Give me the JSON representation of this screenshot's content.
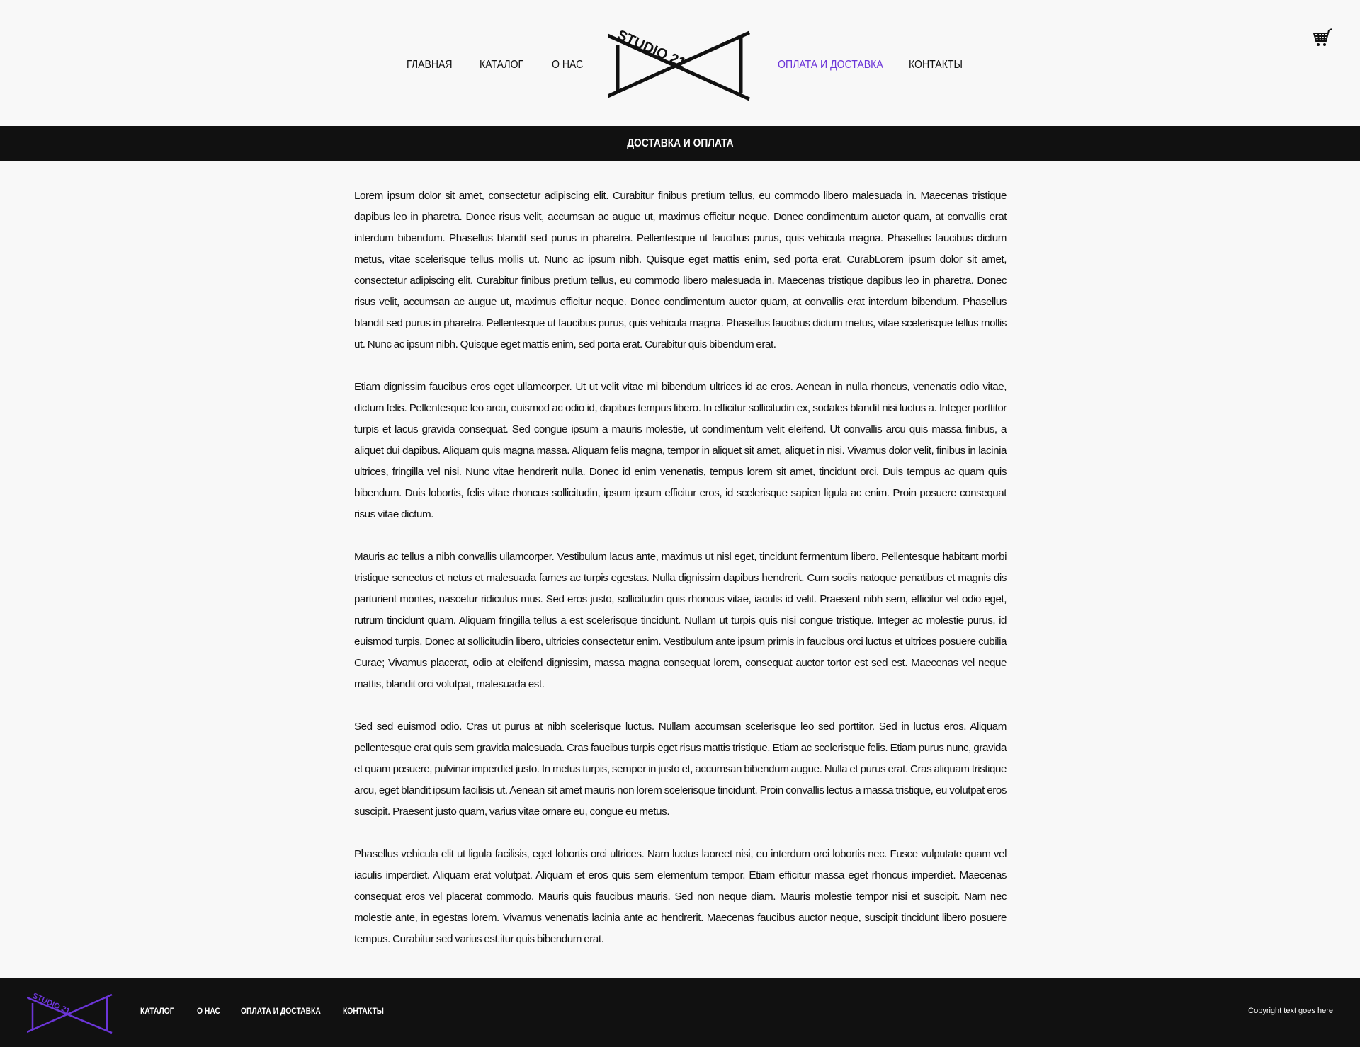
{
  "header": {
    "nav": {
      "home": "ГЛАВНАЯ",
      "catalog": "КАТАЛОГ",
      "about": "О НАС",
      "payment": "ОПЛАТА И ДОСТАВКА",
      "contacts": "КОНТАКТЫ"
    },
    "active_nav": "payment",
    "logo_text": "STUDIO 21",
    "cart_icon": "shopping-cart-icon"
  },
  "colors": {
    "accent": "#6c35d8",
    "bar_bg": "#111111",
    "page_bg": "#f8f8f8"
  },
  "page_title": "ДОСТАВКА И ОПЛАТА",
  "content": {
    "paragraphs": [
      "Lorem ipsum dolor sit amet, consectetur adipiscing elit. Curabitur finibus pretium tellus, eu commodo libero malesuada in. Maecenas tristique dapibus leo in pharetra. Donec risus velit, accumsan ac augue ut, maximus efficitur neque. Donec condimentum auctor quam, at convallis erat interdum bibendum. Phasellus blandit sed purus in pharetra. Pellentesque ut faucibus purus, quis vehicula magna. Phasellus faucibus dictum metus, vitae scelerisque tellus mollis ut. Nunc ac ipsum nibh. Quisque eget mattis enim, sed porta erat. CurabLorem ipsum dolor sit amet, consectetur adipiscing elit. Curabitur finibus pretium tellus, eu commodo libero malesuada in. Maecenas tristique dapibus leo in pharetra. Donec risus velit, accumsan ac augue ut, maximus efficitur neque. Donec condimentum auctor quam, at convallis erat interdum bibendum. Phasellus blandit sed purus in pharetra. Pellentesque ut faucibus purus, quis vehicula magna. Phasellus faucibus dictum metus, vitae scelerisque tellus mollis ut. Nunc ac ipsum nibh. Quisque eget mattis enim, sed porta erat. Curabitur quis bibendum erat.",
      "Etiam dignissim faucibus eros eget ullamcorper. Ut ut velit vitae mi bibendum ultrices id ac eros. Aenean in nulla rhoncus, venenatis odio vitae, dictum felis. Pellentesque leo arcu, euismod ac odio id, dapibus tempus libero. In efficitur sollicitudin ex, sodales blandit nisi luctus a. Integer porttitor turpis et lacus gravida consequat. Sed congue ipsum a mauris molestie, ut condimentum velit eleifend. Ut convallis arcu quis massa finibus, a aliquet dui dapibus. Aliquam quis magna massa. Aliquam felis magna, tempor in aliquet sit amet, aliquet in nisi. Vivamus dolor velit, finibus in lacinia ultrices, fringilla vel nisi. Nunc vitae hendrerit nulla. Donec id enim venenatis, tempus lorem sit amet, tincidunt orci. Duis tempus ac quam quis bibendum. Duis lobortis, felis vitae rhoncus sollicitudin, ipsum ipsum efficitur eros, id scelerisque sapien ligula ac enim. Proin posuere consequat risus vitae dictum.",
      "Mauris ac tellus a nibh convallis ullamcorper. Vestibulum lacus ante, maximus ut nisl eget, tincidunt fermentum libero. Pellentesque habitant morbi tristique senectus et netus et malesuada fames ac turpis egestas. Nulla dignissim dapibus hendrerit. Cum sociis natoque penatibus et magnis dis parturient montes, nascetur ridiculus mus. Sed eros justo, sollicitudin quis rhoncus vitae, iaculis id velit. Praesent nibh sem, efficitur vel odio eget, rutrum tincidunt quam. Aliquam fringilla tellus a est scelerisque tincidunt. Nullam ut turpis quis nisi congue tristique. Integer ac molestie purus, id euismod turpis. Donec at sollicitudin libero, ultricies consectetur enim. Vestibulum ante ipsum primis in faucibus orci luctus et ultrices posuere cubilia Curae; Vivamus placerat, odio at eleifend dignissim, massa magna consequat lorem, consequat auctor tortor est sed est. Maecenas vel neque mattis, blandit orci volutpat, malesuada est.",
      "Sed sed euismod odio. Cras ut purus at nibh scelerisque luctus. Nullam accumsan scelerisque leo sed porttitor. Sed in luctus eros. Aliquam pellentesque erat quis sem gravida malesuada. Cras faucibus turpis eget risus mattis tristique. Etiam ac scelerisque felis. Etiam purus nunc, gravida et quam posuere, pulvinar imperdiet justo. In metus turpis, semper in justo et, accumsan bibendum augue. Nulla et purus erat. Cras aliquam tristique arcu, eget blandit ipsum facilisis ut. Aenean sit amet mauris non lorem scelerisque tincidunt. Proin convallis lectus a massa tristique, eu volutpat eros suscipit. Praesent justo quam, varius vitae ornare eu, congue eu metus.",
      "Phasellus vehicula elit ut ligula facilisis, eget lobortis orci ultrices. Nam luctus laoreet nisi, eu interdum orci lobortis nec. Fusce vulputate quam vel iaculis imperdiet. Aliquam erat volutpat. Aliquam et eros quis sem elementum tempor. Etiam efficitur massa eget rhoncus imperdiet. Maecenas consequat eros vel placerat commodo. Mauris quis faucibus mauris. Sed non neque diam. Mauris molestie tempor nisi et suscipit. Nam nec molestie ante, in egestas lorem. Vivamus venenatis lacinia ante ac hendrerit. Maecenas faucibus auctor neque, suscipit tincidunt libero posuere tempus. Curabitur sed varius est.itur quis bibendum erat."
    ]
  },
  "footer": {
    "logo_text": "STUDIO 21",
    "nav": {
      "catalog": "КАТАЛОГ",
      "about": "О НАС",
      "payment": "ОПЛАТА И ДОСТАВКА",
      "contacts": "КОНТАКТЫ"
    },
    "copyright": "Copyright text goes here"
  }
}
